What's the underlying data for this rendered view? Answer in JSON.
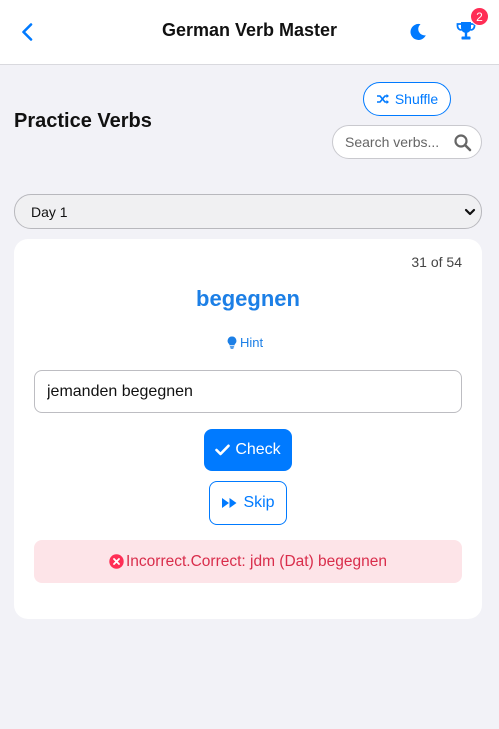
{
  "header": {
    "title": "German Verb Master",
    "notification_count": "2",
    "icons": {
      "back": "chevron-left-icon",
      "theme": "moon-icon",
      "achievements": "trophy-icon"
    }
  },
  "practice": {
    "title": "Practice Verbs",
    "shuffle_label": "Shuffle",
    "search_placeholder": "Search verbs..."
  },
  "day_select": {
    "selected": "Day 1"
  },
  "card": {
    "counter": "31 of 54",
    "verb": "begegnen",
    "hint_label": "Hint",
    "answer_value": "jemanden begegnen",
    "check_label": "Check",
    "skip_label": "Skip",
    "feedback": "Incorrect.Correct: jdm (Dat) begegnen"
  },
  "colors": {
    "accent": "#007aff",
    "error_text": "#d92d4b",
    "error_bg": "#fde4e8",
    "badge": "#ff2d55"
  }
}
